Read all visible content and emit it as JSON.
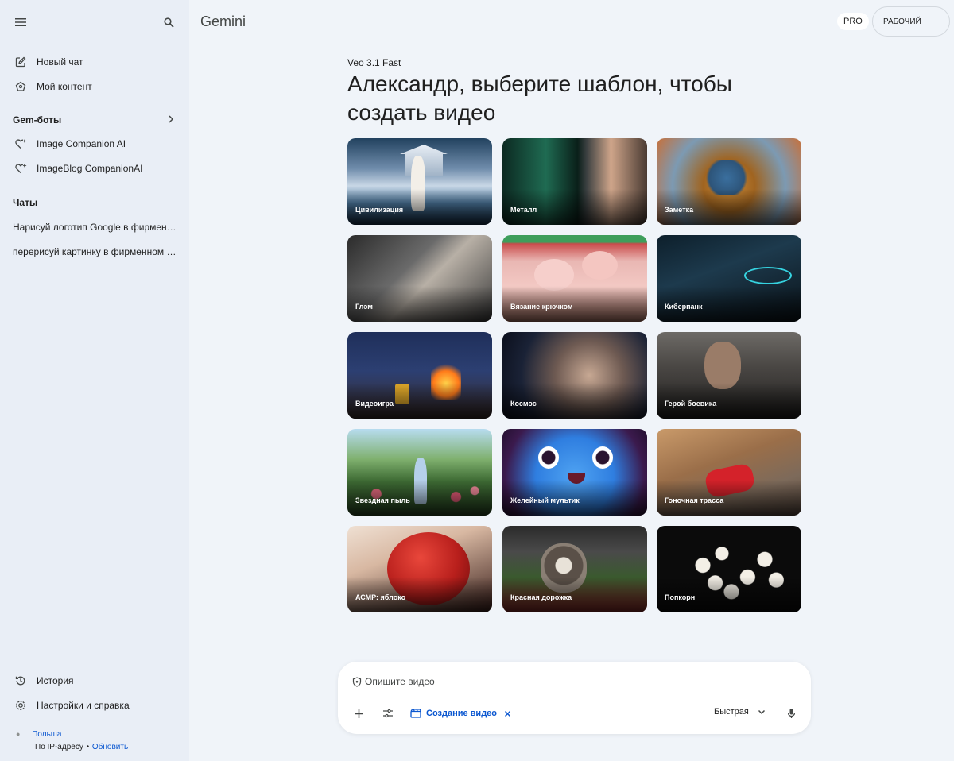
{
  "app": {
    "title": "Gemini",
    "pro_badge": "PRO",
    "workspace": "РАБОЧИЙ"
  },
  "sidebar": {
    "new_chat": "Новый чат",
    "my_content": "Мой контент",
    "gems_title": "Gem-боты",
    "gems": [
      "Image Companion AI",
      "ImageBlog CompanionAI"
    ],
    "chats_title": "Чаты",
    "chats": [
      "Нарисуй логотип Google в фирменн...",
      "перерисуй картинку в фирменном с..."
    ],
    "history": "История",
    "settings": "Настройки и справка",
    "location": {
      "country": "Польша",
      "by_ip": "По IP-адресу",
      "separator": "•",
      "update": "Обновить"
    }
  },
  "main": {
    "model": "Veo 3.1 Fast",
    "headline": "Александр, выберите шаблон, чтобы создать видео",
    "templates": [
      "Цивилизация",
      "Металл",
      "Заметка",
      "Глэм",
      "Вязание крючком",
      "Киберпанк",
      "Видеоигра",
      "Космос",
      "Герой боевика",
      "Звездная пыль",
      "Желейный мультик",
      "Гоночная трасса",
      "АСМР: яблоко",
      "Красная дорожка",
      "Попкорн"
    ]
  },
  "composer": {
    "placeholder": "Опишите видео",
    "chip_label": "Создание видео",
    "speed": "Быстрая"
  },
  "colors": {
    "accent": "#0b57d0",
    "sidebar_bg": "#e9eef6",
    "main_bg": "#f0f4f9"
  },
  "icons": [
    "menu-icon",
    "search-icon",
    "edit-icon",
    "gem-content-icon",
    "chevron-right-icon",
    "gem-icon",
    "history-icon",
    "settings-icon",
    "shield-icon",
    "plus-icon",
    "tune-icon",
    "clapperboard-icon",
    "close-icon",
    "chevron-down-icon",
    "mic-icon"
  ]
}
